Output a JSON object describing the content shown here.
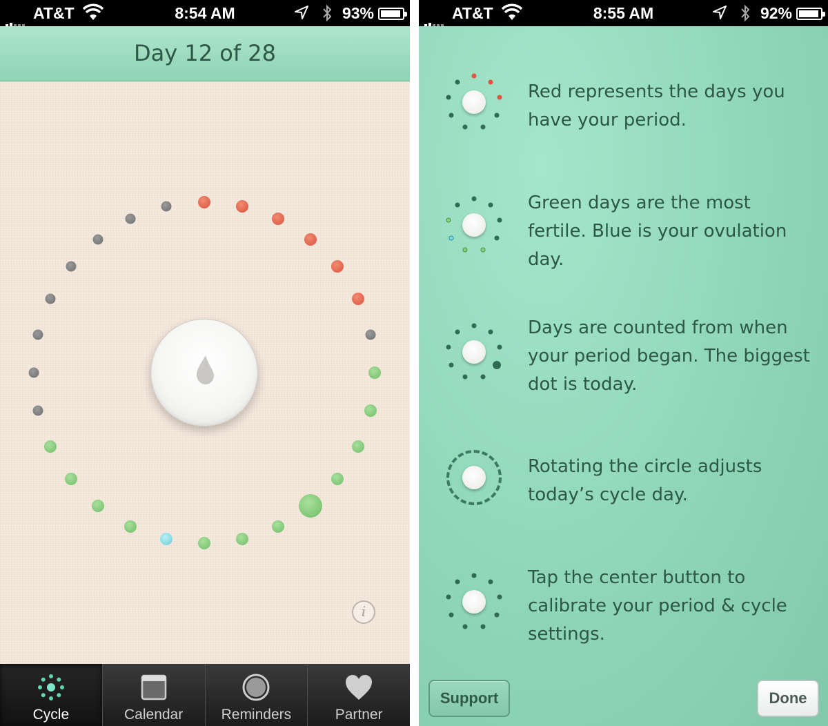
{
  "left": {
    "status": {
      "carrier": "AT&T",
      "time": "8:54 AM",
      "battery": "93%",
      "battery_level": 0.93
    },
    "header": {
      "title": "Day 12 of 28"
    },
    "cycle": {
      "days": 28,
      "today_day": 12,
      "day_colors": [
        "red",
        "red",
        "red",
        "red",
        "red",
        "red",
        "gray",
        "green",
        "green",
        "green",
        "green",
        "green",
        "green",
        "green",
        "green",
        "blue",
        "green",
        "green",
        "green",
        "green",
        "gray",
        "gray",
        "gray",
        "gray",
        "gray",
        "gray",
        "gray",
        "gray"
      ],
      "today_index": 11,
      "colors": {
        "red": "#e0553d",
        "gray": "#7c7c7c",
        "green": "#86cc7a",
        "blue": "#8ee0e8"
      }
    },
    "center_button": {
      "icon": "drop-icon"
    },
    "info_button": {
      "label": "i"
    },
    "tabs": [
      {
        "label": "Cycle",
        "icon": "cycle-dots-icon",
        "active": true
      },
      {
        "label": "Calendar",
        "icon": "calendar-icon",
        "active": false
      },
      {
        "label": "Reminders",
        "icon": "reminders-circle-icon",
        "active": false
      },
      {
        "label": "Partner",
        "icon": "heart-icon",
        "active": false
      }
    ]
  },
  "right": {
    "status": {
      "carrier": "AT&T",
      "time": "8:55 AM",
      "battery": "92%",
      "battery_level": 0.92
    },
    "help": [
      {
        "text": "Red represents the days you have your period.",
        "icon": "period-red-icon"
      },
      {
        "text": "Green days are the most fertile. Blue is your ovulation day.",
        "icon": "fertile-green-icon"
      },
      {
        "text": "Days are counted from when your period began. The biggest dot is today.",
        "icon": "today-biggest-dot-icon"
      },
      {
        "text": "Rotating the circle adjusts today’s cycle day.",
        "icon": "rotate-circle-icon"
      },
      {
        "text": "Tap the center button to calibrate your period & cycle settings.",
        "icon": "center-button-icon"
      }
    ],
    "buttons": {
      "support": "Support",
      "done": "Done"
    }
  }
}
